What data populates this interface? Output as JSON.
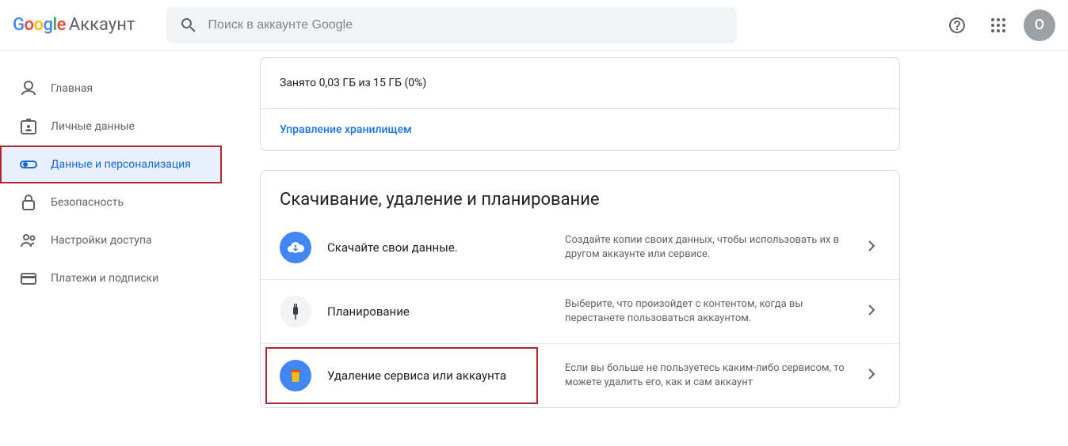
{
  "header": {
    "product": "Аккаунт",
    "search_placeholder": "Поиск в аккаунте Google",
    "avatar_letter": "O"
  },
  "sidebar": {
    "items": [
      {
        "label": "Главная",
        "icon": "home"
      },
      {
        "label": "Личные данные",
        "icon": "id"
      },
      {
        "label": "Данные и персонализация",
        "icon": "toggle",
        "active": true
      },
      {
        "label": "Безопасность",
        "icon": "lock"
      },
      {
        "label": "Настройки доступа",
        "icon": "people"
      },
      {
        "label": "Платежи и подписки",
        "icon": "card"
      }
    ]
  },
  "storage": {
    "text": "Занято 0,03 ГБ из 15 ГБ (0%)",
    "manage": "Управление хранилищем"
  },
  "section": {
    "title": "Скачивание, удаление и планирование",
    "rows": [
      {
        "label": "Скачайте свои данные.",
        "desc": "Создайте копии своих данных, чтобы использовать их в другом аккаунте или сервисе."
      },
      {
        "label": "Планирование",
        "desc": "Выберите, что произойдет с контентом, когда вы перестанете пользоваться аккаунтом."
      },
      {
        "label": "Удаление сервиса или аккаунта",
        "desc": "Если вы больше не пользуетесь каким-либо сервисом, то можете удалить его, как и сам аккаунт"
      }
    ]
  }
}
